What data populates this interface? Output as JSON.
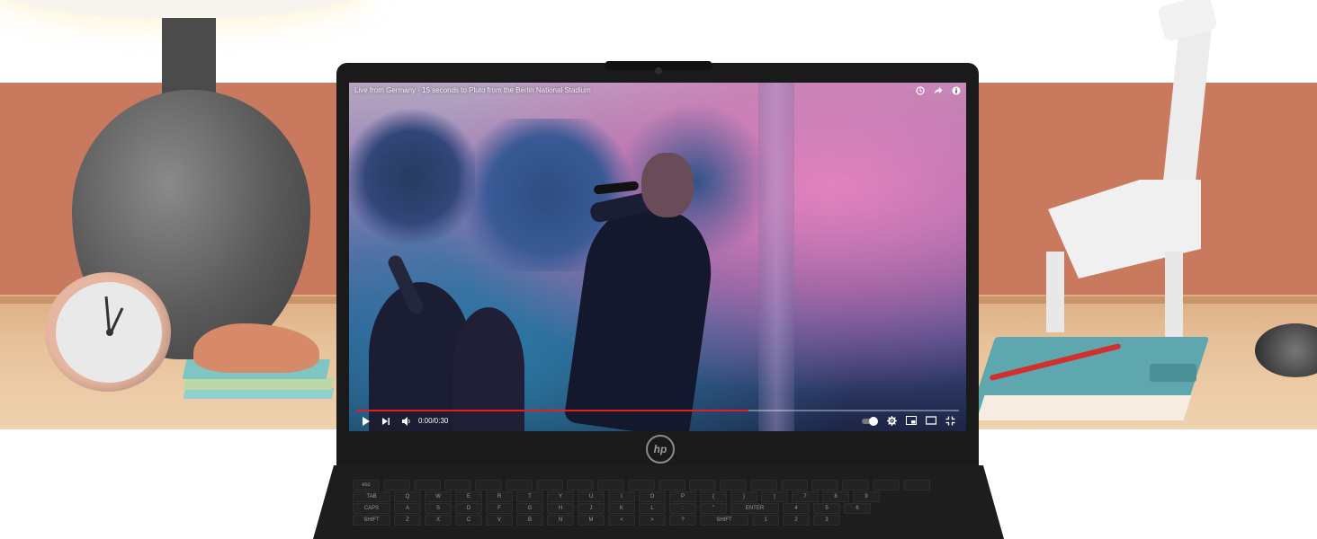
{
  "video": {
    "title": "Live from Germany - 15 seconds to Pluto from the Berlin National Stadium",
    "time_display": "0:00/0:30",
    "progress": 0.65,
    "accent_color": "#e02020"
  },
  "laptop": {
    "brand_logo": "hp"
  },
  "icons": {
    "top": [
      "clock-icon",
      "share-icon",
      "info-icon"
    ],
    "controls_left": [
      "play-icon",
      "next-icon",
      "volume-icon"
    ],
    "controls_right": [
      "autoplay-toggle-icon",
      "settings-icon",
      "miniplayer-icon",
      "theater-icon",
      "fullscreen-icon"
    ]
  },
  "keyboard": {
    "row1": [
      "esc",
      "",
      "",
      "",
      "",
      "",
      "",
      "",
      "",
      "",
      "",
      "",
      "",
      "",
      "",
      "",
      "",
      "",
      ""
    ],
    "row2": [
      "TAB",
      "Q",
      "W",
      "E",
      "R",
      "T",
      "Y",
      "U",
      "I",
      "O",
      "P",
      "{",
      "}",
      "|",
      "7",
      "8",
      "9"
    ],
    "row3": [
      "CAPS",
      "A",
      "S",
      "D",
      "F",
      "G",
      "H",
      "J",
      "K",
      "L",
      ":",
      "\"",
      "ENTER",
      "4",
      "5",
      "6"
    ],
    "row4": [
      "SHIFT",
      "Z",
      "X",
      "C",
      "V",
      "B",
      "N",
      "M",
      "<",
      ">",
      "?",
      "SHIFT",
      "1",
      "2",
      "3"
    ]
  }
}
